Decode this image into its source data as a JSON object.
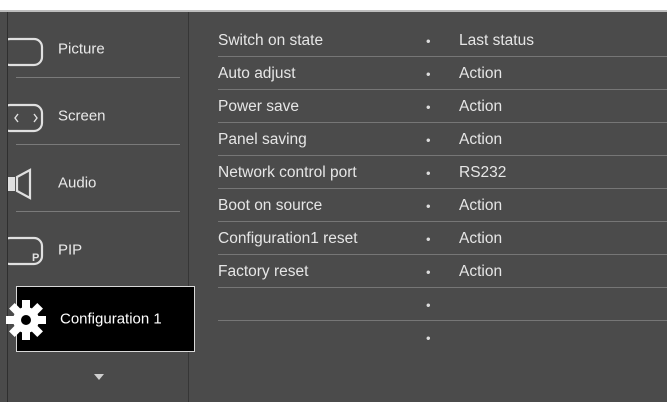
{
  "sidebar": {
    "items": [
      {
        "label": "Picture",
        "icon": "picture-icon"
      },
      {
        "label": "Screen",
        "icon": "screen-icon"
      },
      {
        "label": "Audio",
        "icon": "speaker-icon"
      },
      {
        "label": "PIP",
        "icon": "pip-icon"
      },
      {
        "label": "Configuration 1",
        "icon": "gear-icon",
        "active": true
      }
    ],
    "more_icon": "chevron-down-icon"
  },
  "settings": [
    {
      "name": "Switch on state",
      "value": "Last status"
    },
    {
      "name": "Auto adjust",
      "value": "Action"
    },
    {
      "name": "Power save",
      "value": "Action"
    },
    {
      "name": "Panel saving",
      "value": "Action"
    },
    {
      "name": "Network control port",
      "value": "RS232"
    },
    {
      "name": "Boot on source",
      "value": "Action"
    },
    {
      "name": "Configuration1 reset",
      "value": "Action"
    },
    {
      "name": "Factory reset",
      "value": "Action"
    },
    {
      "name": "",
      "value": ""
    },
    {
      "name": "",
      "value": ""
    }
  ],
  "colors": {
    "background": "#4b4b4b",
    "active_item": "#000000",
    "text": "#e6e6e6"
  }
}
